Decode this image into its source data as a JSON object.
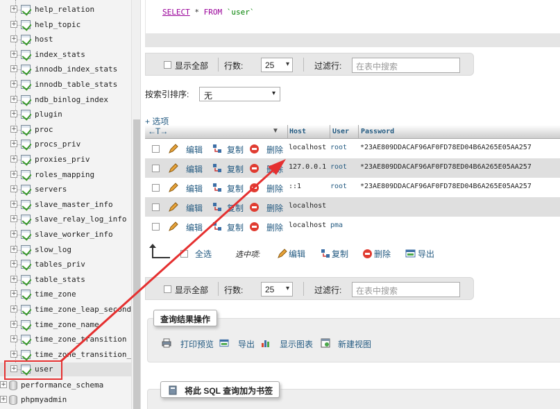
{
  "nav": {
    "tables": [
      {
        "name": "help_relation"
      },
      {
        "name": "help_topic"
      },
      {
        "name": "host"
      },
      {
        "name": "index_stats"
      },
      {
        "name": "innodb_index_stats"
      },
      {
        "name": "innodb_table_stats"
      },
      {
        "name": "ndb_binlog_index"
      },
      {
        "name": "plugin"
      },
      {
        "name": "proc"
      },
      {
        "name": "procs_priv"
      },
      {
        "name": "proxies_priv"
      },
      {
        "name": "roles_mapping"
      },
      {
        "name": "servers"
      },
      {
        "name": "slave_master_info"
      },
      {
        "name": "slave_relay_log_info"
      },
      {
        "name": "slave_worker_info"
      },
      {
        "name": "slow_log"
      },
      {
        "name": "tables_priv"
      },
      {
        "name": "table_stats"
      },
      {
        "name": "time_zone"
      },
      {
        "name": "time_zone_leap_second"
      },
      {
        "name": "time_zone_name"
      },
      {
        "name": "time_zone_transition"
      },
      {
        "name": "time_zone_transition_type"
      },
      {
        "name": "user"
      }
    ],
    "databases": [
      "performance_schema",
      "phpmyadmin"
    ],
    "active_table": "user"
  },
  "query": {
    "select": "SELECT",
    "star": "*",
    "from": "FROM",
    "table": "`user`"
  },
  "pager": {
    "show_all": "显示全部",
    "rows_label": "行数:",
    "rows_value": "25",
    "filter_label": "过滤行:",
    "filter_placeholder": "在表中搜索"
  },
  "sort": {
    "label": "按索引排序:",
    "value": "无"
  },
  "options_link": "+ 选项",
  "table": {
    "col_arrows": "←T→",
    "columns": [
      "Host",
      "User",
      "Password"
    ],
    "actions": {
      "edit": "编辑",
      "copy": "复制",
      "delete": "删除"
    },
    "rows": [
      {
        "host": "localhost",
        "user": "root",
        "password": "*23AE809DDACAF96AF0FD78ED04B6A265E05AA257"
      },
      {
        "host": "127.0.0.1",
        "user": "root",
        "password": "*23AE809DDACAF96AF0FD78ED04B6A265E05AA257"
      },
      {
        "host": "::1",
        "user": "root",
        "password": "*23AE809DDACAF96AF0FD78ED04B6A265E05AA257"
      },
      {
        "host": "localhost",
        "user": "",
        "password": ""
      },
      {
        "host": "localhost",
        "user": "pma",
        "password": ""
      }
    ]
  },
  "with_selected": {
    "check_all": "全选",
    "label": "选中项:",
    "edit": "编辑",
    "copy": "复制",
    "delete": "删除",
    "export": "导出"
  },
  "query_ops": {
    "title": "查询结果操作",
    "print": "打印预览",
    "export": "导出",
    "chart": "显示图表",
    "view": "新建视图"
  },
  "bookmark": {
    "title": "将此 SQL 查询加为书签"
  },
  "colors": {
    "link": "#235a81",
    "annotation": "#e53030"
  }
}
